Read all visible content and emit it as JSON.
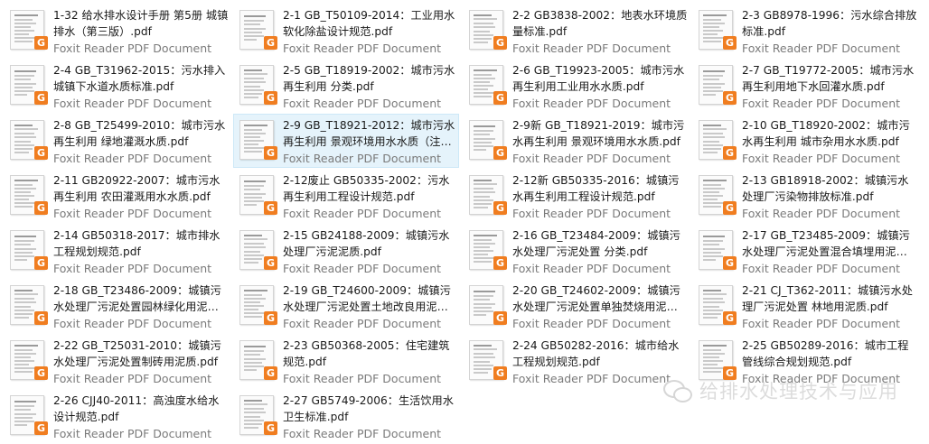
{
  "files": [
    {
      "name": "1-32 给水排水设计手册 第5册 城镇排水（第三版）.pdf",
      "type": "Foxit Reader PDF Document"
    },
    {
      "name": "2-1 GB_T50109-2014：工业用水软化除盐设计规范.pdf",
      "type": "Foxit Reader PDF Document"
    },
    {
      "name": "2-2 GB3838-2002：地表水环境质量标准.pdf",
      "type": "Foxit Reader PDF Document"
    },
    {
      "name": "2-3 GB8978-1996：污水综合排放标准.pdf",
      "type": "Foxit Reader PDF Document"
    },
    {
      "name": "2-4 GB_T31962-2015：污水排入城镇下水道水质标准.pdf",
      "type": "Foxit Reader PDF Document"
    },
    {
      "name": "2-5 GB_T18919-2002：城市污水再生利用 分类.pdf",
      "type": "Foxit Reader PDF Document"
    },
    {
      "name": "2-6 GB_T19923-2005：城市污水再生利用工业用水水质.pdf",
      "type": "Foxit Reader PDF Document"
    },
    {
      "name": "2-7 GB_T19772-2005：城市污水再生利用地下水回灌水质.pdf",
      "type": "Foxit Reader PDF Document"
    },
    {
      "name": "2-8 GB_T25499-2010：城市污水再生利用 绿地灌溉水质.pdf",
      "type": "Foxit Reader PDF Document"
    },
    {
      "name": "2-9 GB_T18921-2012：城市污水再生利用 景观环境用水水质（注…",
      "type": "Foxit Reader PDF Document"
    },
    {
      "name": "2-9新 GB_T18921-2019：城市污水再生利用 景观环境用水水质.pdf",
      "type": "Foxit Reader PDF Document"
    },
    {
      "name": "2-10 GB_T18920-2002：城市污水再生利用 城市杂用水水质.pdf",
      "type": "Foxit Reader PDF Document"
    },
    {
      "name": "2-11 GB20922-2007：城市污水再生利用 农田灌溉用水水质.pdf",
      "type": "Foxit Reader PDF Document"
    },
    {
      "name": "2-12废止 GB50335-2002：污水再生利用工程设计规范.pdf",
      "type": "Foxit Reader PDF Document"
    },
    {
      "name": "2-12新 GB50335-2016：城镇污水再生利用工程设计规范.pdf",
      "type": "Foxit Reader PDF Document"
    },
    {
      "name": "2-13 GB18918-2002：城镇污水处理厂污染物排放标准.pdf",
      "type": "Foxit Reader PDF Document"
    },
    {
      "name": "2-14 GB50318-2017：城市排水工程规划规范.pdf",
      "type": "Foxit Reader PDF Document"
    },
    {
      "name": "2-15 GB24188-2009：城镇污水处理厂污泥泥质.pdf",
      "type": "Foxit Reader PDF Document"
    },
    {
      "name": "2-16 GB_T23484-2009：城镇污水处理厂污泥处置 分类.pdf",
      "type": "Foxit Reader PDF Document"
    },
    {
      "name": "2-17 GB_T23485-2009：城镇污水处理厂污泥处置混合填埋用泥…",
      "type": "Foxit Reader PDF Document"
    },
    {
      "name": "2-18 GB_T23486-2009：城镇污水处理厂污泥处置园林绿化用泥…",
      "type": "Foxit Reader PDF Document"
    },
    {
      "name": "2-19 GB_T24600-2009：城镇污水处理厂污泥处置土地改良用泥…",
      "type": "Foxit Reader PDF Document"
    },
    {
      "name": "2-20 GB_T24602-2009：城镇污水处理厂污泥处置单独焚烧用泥…",
      "type": "Foxit Reader PDF Document"
    },
    {
      "name": "2-21 CJ_T362-2011：城镇污水处理厂污泥处置 林地用泥质.pdf",
      "type": "Foxit Reader PDF Document"
    },
    {
      "name": "2-22 GB_T25031-2010：城镇污水处理厂污泥处置制砖用泥质.pdf",
      "type": "Foxit Reader PDF Document"
    },
    {
      "name": "2-23 GB50368-2005：住宅建筑规范.pdf",
      "type": "Foxit Reader PDF Document"
    },
    {
      "name": "2-24 GB50282-2016：城市给水工程规划规范.pdf",
      "type": "Foxit Reader PDF Document"
    },
    {
      "name": "2-25 GB50289-2016：城市工程管线综合规划规范.pdf",
      "type": "Foxit Reader PDF Document"
    },
    {
      "name": "2-26 CJJ40-2011：高浊度水给水设计规范.pdf",
      "type": "Foxit Reader PDF Document"
    },
    {
      "name": "2-27 GB5749-2006：生活饮用水卫生标准.pdf",
      "type": "Foxit Reader PDF Document"
    }
  ],
  "selected_index": 9,
  "badge_glyph": "G",
  "badge_color": "#f07d20",
  "icon_name": "foxit-pdf-icon",
  "watermark": {
    "text": "给排水处理技术与应用",
    "icon": "wechat-icon"
  }
}
